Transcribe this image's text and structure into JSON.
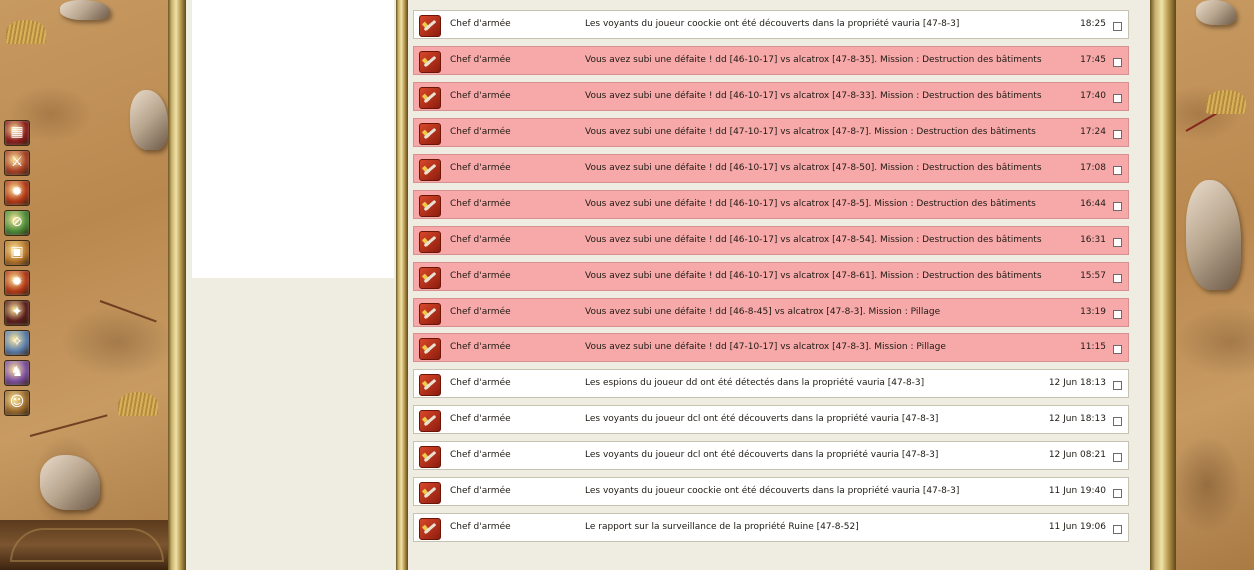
{
  "nav_icons": [
    {
      "name": "calendar-icon",
      "color": "#8b1e1e",
      "glyph": "▦"
    },
    {
      "name": "troops-icon",
      "color": "#a64026",
      "glyph": "⚔"
    },
    {
      "name": "fire-icon",
      "color": "#b33a18",
      "glyph": "✹"
    },
    {
      "name": "no-attack-icon",
      "color": "#4b8d3a",
      "glyph": "⊘"
    },
    {
      "name": "treasure-icon",
      "color": "#b6752a",
      "glyph": "▣"
    },
    {
      "name": "fire-attack-icon",
      "color": "#b33a18",
      "glyph": "✹"
    },
    {
      "name": "scout-icon",
      "color": "#5a1e1e",
      "glyph": "✦"
    },
    {
      "name": "magic-icon",
      "color": "#5b7fae",
      "glyph": "✧"
    },
    {
      "name": "spy-icon",
      "color": "#7b4fa0",
      "glyph": "♞"
    },
    {
      "name": "hero-icon",
      "color": "#9a6a2e",
      "glyph": "☺"
    }
  ],
  "messages": [
    {
      "type": "normal",
      "sender": "Chef d'armée",
      "text": "Les voyants du joueur coockie ont été découverts dans la propriété vauria [47-8-3]",
      "time": "18:25"
    },
    {
      "type": "defeat",
      "sender": "Chef d'armée",
      "text": "Vous avez subi une défaite ! dd [46-10-17] vs alcatrox [47-8-35]. Mission : Destruction des bâtiments",
      "time": "17:45"
    },
    {
      "type": "defeat",
      "sender": "Chef d'armée",
      "text": "Vous avez subi une défaite ! dd [46-10-17] vs alcatrox [47-8-33]. Mission : Destruction des bâtiments",
      "time": "17:40"
    },
    {
      "type": "defeat",
      "sender": "Chef d'armée",
      "text": "Vous avez subi une défaite ! dd [47-10-17] vs alcatrox [47-8-7]. Mission : Destruction des bâtiments",
      "time": "17:24"
    },
    {
      "type": "defeat",
      "sender": "Chef d'armée",
      "text": "Vous avez subi une défaite ! dd [46-10-17] vs alcatrox [47-8-50]. Mission : Destruction des bâtiments",
      "time": "17:08"
    },
    {
      "type": "defeat",
      "sender": "Chef d'armée",
      "text": "Vous avez subi une défaite ! dd [46-10-17] vs alcatrox [47-8-5]. Mission : Destruction des bâtiments",
      "time": "16:44"
    },
    {
      "type": "defeat",
      "sender": "Chef d'armée",
      "text": "Vous avez subi une défaite ! dd [46-10-17] vs alcatrox [47-8-54]. Mission : Destruction des bâtiments",
      "time": "16:31"
    },
    {
      "type": "defeat",
      "sender": "Chef d'armée",
      "text": "Vous avez subi une défaite ! dd [46-10-17] vs alcatrox [47-8-61]. Mission : Destruction des bâtiments",
      "time": "15:57"
    },
    {
      "type": "defeat",
      "sender": "Chef d'armée",
      "text": "Vous avez subi une défaite ! dd [46-8-45] vs alcatrox [47-8-3]. Mission : Pillage",
      "time": "13:19"
    },
    {
      "type": "defeat",
      "sender": "Chef d'armée",
      "text": "Vous avez subi une défaite ! dd [47-10-17] vs alcatrox [47-8-3]. Mission : Pillage",
      "time": "11:15"
    },
    {
      "type": "normal",
      "sender": "Chef d'armée",
      "text": "Les espions du joueur dd ont été détectés dans la propriété vauria [47-8-3]",
      "time": "12 Jun 18:13"
    },
    {
      "type": "normal",
      "sender": "Chef d'armée",
      "text": "Les voyants du joueur dcl ont été découverts dans la propriété vauria [47-8-3]",
      "time": "12 Jun 18:13"
    },
    {
      "type": "normal",
      "sender": "Chef d'armée",
      "text": "Les voyants du joueur dcl ont été découverts dans la propriété vauria [47-8-3]",
      "time": "12 Jun 08:21"
    },
    {
      "type": "normal",
      "sender": "Chef d'armée",
      "text": "Les voyants du joueur coockie ont été découverts dans la propriété vauria [47-8-3]",
      "time": "11 Jun 19:40"
    },
    {
      "type": "normal",
      "sender": "Chef d'armée",
      "text": "Le rapport sur la surveillance de la propriété Ruine [47-8-52]",
      "time": "11 Jun 19:06"
    }
  ]
}
